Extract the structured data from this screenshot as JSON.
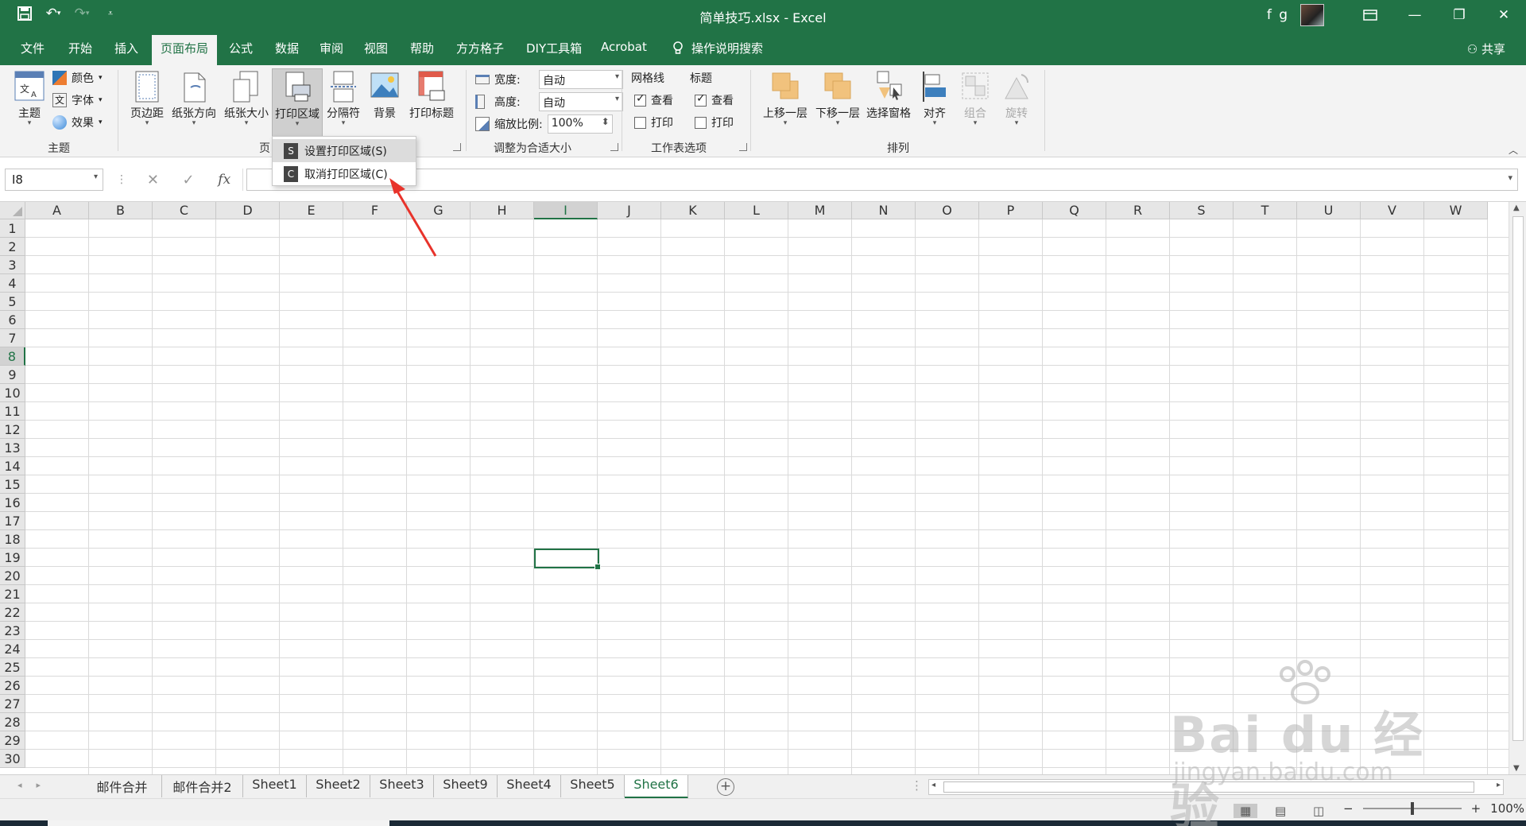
{
  "titlebar": {
    "title": "简单技巧.xlsx  -  Excel",
    "user": "f g"
  },
  "tabs": [
    {
      "label": "文件",
      "active": false
    },
    {
      "label": "开始",
      "active": false
    },
    {
      "label": "插入",
      "active": false
    },
    {
      "label": "页面布局",
      "active": true
    },
    {
      "label": "公式",
      "active": false
    },
    {
      "label": "数据",
      "active": false
    },
    {
      "label": "审阅",
      "active": false
    },
    {
      "label": "视图",
      "active": false
    },
    {
      "label": "帮助",
      "active": false
    },
    {
      "label": "方方格子",
      "active": false
    },
    {
      "label": "DIY工具箱",
      "active": false
    },
    {
      "label": "Acrobat",
      "active": false
    }
  ],
  "tellme": "操作说明搜索",
  "share": "共享",
  "ribbon": {
    "themes": {
      "group_label": "主题",
      "theme_btn": "主题",
      "colors": "颜色",
      "fonts": "字体",
      "effects": "效果"
    },
    "page_setup": {
      "group_label_visible": "页",
      "margins": "页边距",
      "orientation": "纸张方向",
      "size": "纸张大小",
      "print_area": "打印区域",
      "breaks": "分隔符",
      "background": "背景",
      "print_titles": "打印标题"
    },
    "scale": {
      "group_label": "调整为合适大小",
      "width_label": "宽度:",
      "width_value": "自动",
      "height_label": "高度:",
      "height_value": "自动",
      "scale_label": "缩放比例:",
      "scale_value": "100%"
    },
    "sheet_options": {
      "group_label": "工作表选项",
      "gridlines": "网格线",
      "headings": "标题",
      "view": "查看",
      "print": "打印",
      "gridlines_view": true,
      "gridlines_print": false,
      "headings_view": true,
      "headings_print": false
    },
    "arrange": {
      "group_label": "排列",
      "bring_forward": "上移一层",
      "send_backward": "下移一层",
      "selection_pane": "选择窗格",
      "align": "对齐",
      "group": "组合",
      "rotate": "旋转"
    }
  },
  "dropdown": {
    "items": [
      {
        "key": "S",
        "label": "设置打印区域(S)"
      },
      {
        "key": "C",
        "label": "取消打印区域(C)"
      }
    ]
  },
  "formula": {
    "namebox": "I8",
    "fx": "fx",
    "value": ""
  },
  "grid": {
    "columns": [
      "A",
      "B",
      "C",
      "D",
      "E",
      "F",
      "G",
      "H",
      "I",
      "J",
      "K",
      "L",
      "M",
      "N",
      "O",
      "P",
      "Q",
      "R",
      "S",
      "T",
      "U",
      "V",
      "W"
    ],
    "rows": [
      "1",
      "2",
      "3",
      "4",
      "5",
      "6",
      "7",
      "8",
      "9",
      "10",
      "11",
      "12",
      "13",
      "14",
      "15",
      "16",
      "17",
      "18",
      "19",
      "20",
      "21",
      "22",
      "23",
      "24",
      "25",
      "26",
      "27",
      "28",
      "29",
      "30"
    ],
    "selected_column": "I",
    "selected_row": "8"
  },
  "sheets": [
    {
      "label": "邮件合并",
      "active": false
    },
    {
      "label": "邮件合并2",
      "active": false
    },
    {
      "label": "Sheet1",
      "active": false
    },
    {
      "label": "Sheet2",
      "active": false
    },
    {
      "label": "Sheet3",
      "active": false
    },
    {
      "label": "Sheet9",
      "active": false
    },
    {
      "label": "Sheet4",
      "active": false
    },
    {
      "label": "Sheet5",
      "active": false
    },
    {
      "label": "Sheet6",
      "active": true
    }
  ],
  "status": {
    "zoom": "100%"
  },
  "watermark": {
    "main": "Bai du 经验",
    "sub": "jingyan.baidu.com"
  },
  "colors": {
    "accent": "#217346",
    "annotation": "#e8332b"
  }
}
